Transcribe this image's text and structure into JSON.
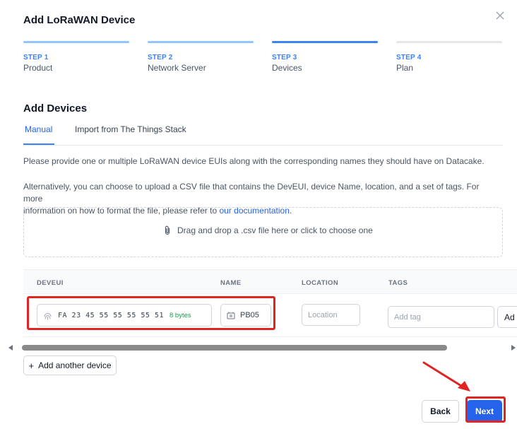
{
  "modal": {
    "title": "Add LoRaWAN Device"
  },
  "steps": [
    {
      "num": "STEP 1",
      "label": "Product",
      "state": "complete",
      "color": "#93c5fd"
    },
    {
      "num": "STEP 2",
      "label": "Network Server",
      "state": "complete",
      "color": "#93c5fd"
    },
    {
      "num": "STEP 3",
      "label": "Devices",
      "state": "current",
      "color": "#3b82f6"
    },
    {
      "num": "STEP 4",
      "label": "Plan",
      "state": "upcoming",
      "color": "#e5e7eb"
    }
  ],
  "section": {
    "title": "Add Devices"
  },
  "tabs": {
    "manual": "Manual",
    "import": "Import from The Things Stack"
  },
  "text": {
    "p1": "Please provide one or multiple LoRaWAN device EUIs along with the corresponding names they should have on Datacake.",
    "p2_line1": "Alternatively, you can choose to upload a CSV file that contains the DevEUI, device Name, location, and a set of tags. For more",
    "p2_line2_prefix": "information on how to format the file, please refer to ",
    "p2_link": "our documentation",
    "p2_suffix": "."
  },
  "dropzone": {
    "label": "Drag and drop a .csv file here or click to choose one",
    "icon": "paperclip-icon"
  },
  "table": {
    "headers": [
      "DEVEUI",
      "NAME",
      "LOCATION",
      "TAGS"
    ],
    "row": {
      "deveui": "FA 23 45 55 55 55 55 51",
      "deveui_bytes": "8 bytes",
      "name": "PB05",
      "location_placeholder": "Location",
      "tag_placeholder": "Add tag",
      "add_tag_label": "Ad"
    }
  },
  "buttons": {
    "add_device": "Add another device",
    "back": "Back",
    "next": "Next"
  },
  "colors": {
    "accent": "#2563eb",
    "annotation": "#e02424"
  }
}
